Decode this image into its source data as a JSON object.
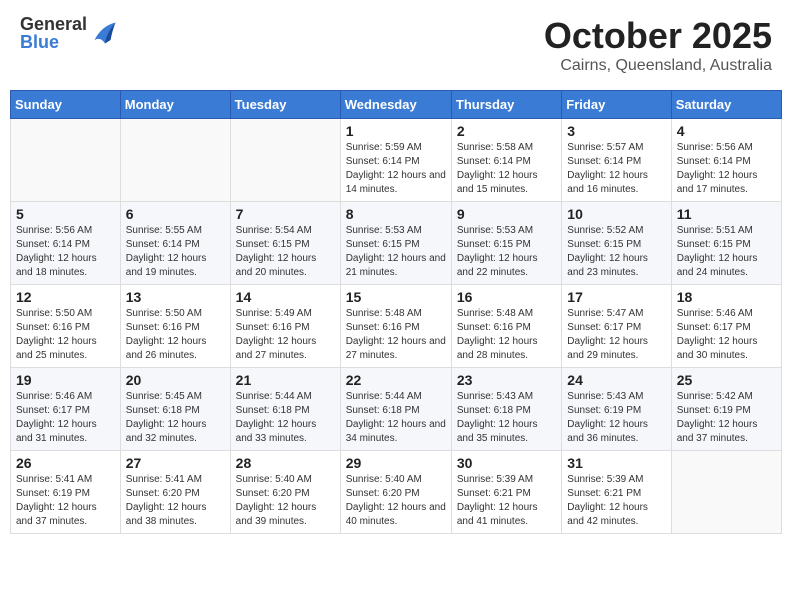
{
  "header": {
    "logo_general": "General",
    "logo_blue": "Blue",
    "month_title": "October 2025",
    "location": "Cairns, Queensland, Australia"
  },
  "weekdays": [
    "Sunday",
    "Monday",
    "Tuesday",
    "Wednesday",
    "Thursday",
    "Friday",
    "Saturday"
  ],
  "weeks": [
    [
      {
        "day": "",
        "sunrise": "",
        "sunset": "",
        "daylight": ""
      },
      {
        "day": "",
        "sunrise": "",
        "sunset": "",
        "daylight": ""
      },
      {
        "day": "",
        "sunrise": "",
        "sunset": "",
        "daylight": ""
      },
      {
        "day": "1",
        "sunrise": "Sunrise: 5:59 AM",
        "sunset": "Sunset: 6:14 PM",
        "daylight": "Daylight: 12 hours and 14 minutes."
      },
      {
        "day": "2",
        "sunrise": "Sunrise: 5:58 AM",
        "sunset": "Sunset: 6:14 PM",
        "daylight": "Daylight: 12 hours and 15 minutes."
      },
      {
        "day": "3",
        "sunrise": "Sunrise: 5:57 AM",
        "sunset": "Sunset: 6:14 PM",
        "daylight": "Daylight: 12 hours and 16 minutes."
      },
      {
        "day": "4",
        "sunrise": "Sunrise: 5:56 AM",
        "sunset": "Sunset: 6:14 PM",
        "daylight": "Daylight: 12 hours and 17 minutes."
      }
    ],
    [
      {
        "day": "5",
        "sunrise": "Sunrise: 5:56 AM",
        "sunset": "Sunset: 6:14 PM",
        "daylight": "Daylight: 12 hours and 18 minutes."
      },
      {
        "day": "6",
        "sunrise": "Sunrise: 5:55 AM",
        "sunset": "Sunset: 6:14 PM",
        "daylight": "Daylight: 12 hours and 19 minutes."
      },
      {
        "day": "7",
        "sunrise": "Sunrise: 5:54 AM",
        "sunset": "Sunset: 6:15 PM",
        "daylight": "Daylight: 12 hours and 20 minutes."
      },
      {
        "day": "8",
        "sunrise": "Sunrise: 5:53 AM",
        "sunset": "Sunset: 6:15 PM",
        "daylight": "Daylight: 12 hours and 21 minutes."
      },
      {
        "day": "9",
        "sunrise": "Sunrise: 5:53 AM",
        "sunset": "Sunset: 6:15 PM",
        "daylight": "Daylight: 12 hours and 22 minutes."
      },
      {
        "day": "10",
        "sunrise": "Sunrise: 5:52 AM",
        "sunset": "Sunset: 6:15 PM",
        "daylight": "Daylight: 12 hours and 23 minutes."
      },
      {
        "day": "11",
        "sunrise": "Sunrise: 5:51 AM",
        "sunset": "Sunset: 6:15 PM",
        "daylight": "Daylight: 12 hours and 24 minutes."
      }
    ],
    [
      {
        "day": "12",
        "sunrise": "Sunrise: 5:50 AM",
        "sunset": "Sunset: 6:16 PM",
        "daylight": "Daylight: 12 hours and 25 minutes."
      },
      {
        "day": "13",
        "sunrise": "Sunrise: 5:50 AM",
        "sunset": "Sunset: 6:16 PM",
        "daylight": "Daylight: 12 hours and 26 minutes."
      },
      {
        "day": "14",
        "sunrise": "Sunrise: 5:49 AM",
        "sunset": "Sunset: 6:16 PM",
        "daylight": "Daylight: 12 hours and 27 minutes."
      },
      {
        "day": "15",
        "sunrise": "Sunrise: 5:48 AM",
        "sunset": "Sunset: 6:16 PM",
        "daylight": "Daylight: 12 hours and 27 minutes."
      },
      {
        "day": "16",
        "sunrise": "Sunrise: 5:48 AM",
        "sunset": "Sunset: 6:16 PM",
        "daylight": "Daylight: 12 hours and 28 minutes."
      },
      {
        "day": "17",
        "sunrise": "Sunrise: 5:47 AM",
        "sunset": "Sunset: 6:17 PM",
        "daylight": "Daylight: 12 hours and 29 minutes."
      },
      {
        "day": "18",
        "sunrise": "Sunrise: 5:46 AM",
        "sunset": "Sunset: 6:17 PM",
        "daylight": "Daylight: 12 hours and 30 minutes."
      }
    ],
    [
      {
        "day": "19",
        "sunrise": "Sunrise: 5:46 AM",
        "sunset": "Sunset: 6:17 PM",
        "daylight": "Daylight: 12 hours and 31 minutes."
      },
      {
        "day": "20",
        "sunrise": "Sunrise: 5:45 AM",
        "sunset": "Sunset: 6:18 PM",
        "daylight": "Daylight: 12 hours and 32 minutes."
      },
      {
        "day": "21",
        "sunrise": "Sunrise: 5:44 AM",
        "sunset": "Sunset: 6:18 PM",
        "daylight": "Daylight: 12 hours and 33 minutes."
      },
      {
        "day": "22",
        "sunrise": "Sunrise: 5:44 AM",
        "sunset": "Sunset: 6:18 PM",
        "daylight": "Daylight: 12 hours and 34 minutes."
      },
      {
        "day": "23",
        "sunrise": "Sunrise: 5:43 AM",
        "sunset": "Sunset: 6:18 PM",
        "daylight": "Daylight: 12 hours and 35 minutes."
      },
      {
        "day": "24",
        "sunrise": "Sunrise: 5:43 AM",
        "sunset": "Sunset: 6:19 PM",
        "daylight": "Daylight: 12 hours and 36 minutes."
      },
      {
        "day": "25",
        "sunrise": "Sunrise: 5:42 AM",
        "sunset": "Sunset: 6:19 PM",
        "daylight": "Daylight: 12 hours and 37 minutes."
      }
    ],
    [
      {
        "day": "26",
        "sunrise": "Sunrise: 5:41 AM",
        "sunset": "Sunset: 6:19 PM",
        "daylight": "Daylight: 12 hours and 37 minutes."
      },
      {
        "day": "27",
        "sunrise": "Sunrise: 5:41 AM",
        "sunset": "Sunset: 6:20 PM",
        "daylight": "Daylight: 12 hours and 38 minutes."
      },
      {
        "day": "28",
        "sunrise": "Sunrise: 5:40 AM",
        "sunset": "Sunset: 6:20 PM",
        "daylight": "Daylight: 12 hours and 39 minutes."
      },
      {
        "day": "29",
        "sunrise": "Sunrise: 5:40 AM",
        "sunset": "Sunset: 6:20 PM",
        "daylight": "Daylight: 12 hours and 40 minutes."
      },
      {
        "day": "30",
        "sunrise": "Sunrise: 5:39 AM",
        "sunset": "Sunset: 6:21 PM",
        "daylight": "Daylight: 12 hours and 41 minutes."
      },
      {
        "day": "31",
        "sunrise": "Sunrise: 5:39 AM",
        "sunset": "Sunset: 6:21 PM",
        "daylight": "Daylight: 12 hours and 42 minutes."
      },
      {
        "day": "",
        "sunrise": "",
        "sunset": "",
        "daylight": ""
      }
    ]
  ]
}
